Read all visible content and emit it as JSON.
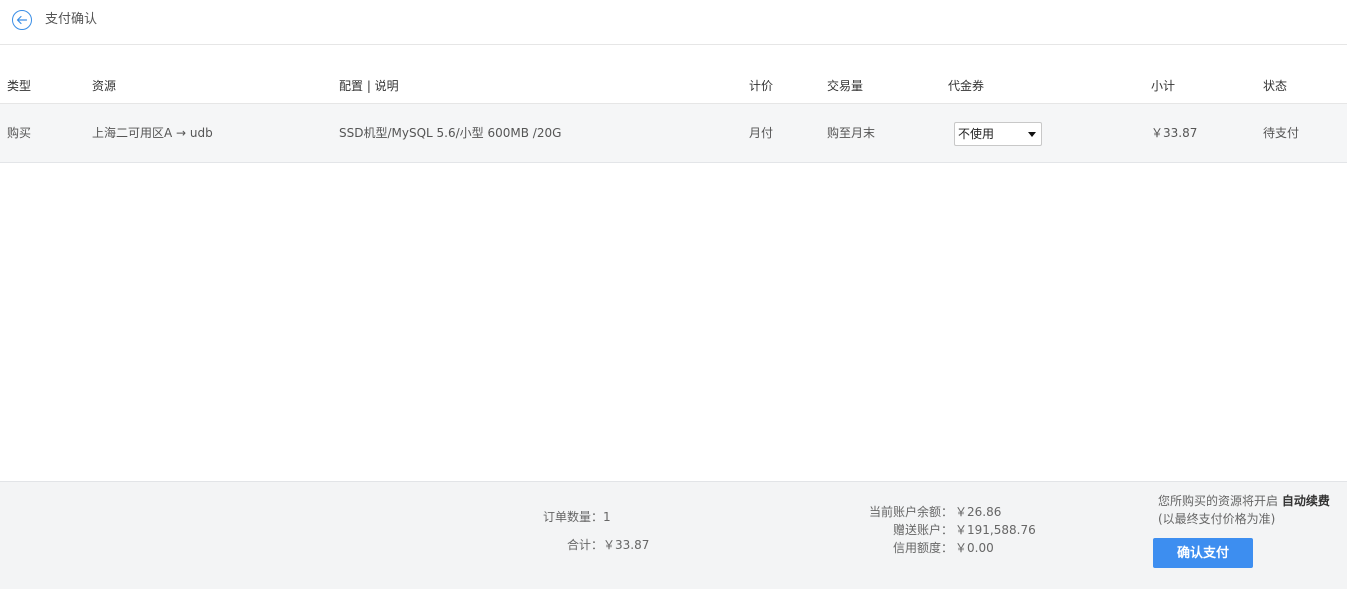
{
  "header": {
    "title": "支付确认"
  },
  "table": {
    "headers": {
      "type": "类型",
      "resource": "资源",
      "config": "配置 | 说明",
      "pricing": "计价",
      "quantity": "交易量",
      "coupon": "代金券",
      "subtotal": "小计",
      "status": "状态"
    },
    "rows": [
      {
        "type": "购买",
        "resource": "上海二可用区A → udb",
        "config": "SSD机型/MySQL 5.6/小型 600MB /20G",
        "pricing": "月付",
        "quantity": "购至月末",
        "coupon": "不使用",
        "subtotal": "￥33.87",
        "status": "待支付"
      }
    ]
  },
  "footer": {
    "order_count_label": "订单数量：",
    "order_count": "1",
    "total_label": "合计：",
    "total": "￥33.87",
    "balance_label": "当前账户余额：",
    "balance": "￥26.86",
    "gift_label": "赠送账户：",
    "gift": "￥191,588.76",
    "credit_label": "信用额度：",
    "credit": "￥0.00",
    "renew_note_prefix": "您所购买的资源将开启 ",
    "renew_note_strong": "自动续费",
    "renew_note_sub": "(以最终支付价格为准)",
    "confirm_label": "确认支付"
  },
  "colors": {
    "accent": "#3d8ef0",
    "row_bg": "#f5f6f7",
    "footer_bg": "#f3f4f5"
  }
}
